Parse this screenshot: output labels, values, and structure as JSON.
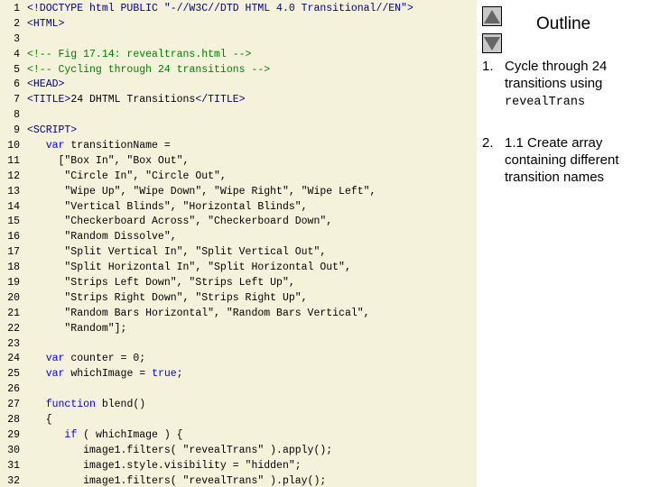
{
  "code": {
    "lines": [
      {
        "n": "1",
        "parts": [
          [
            "tag",
            "<!DOCTYPE html PUBLIC \"-//W3C//DTD HTML 4.0 Transitional//EN\">"
          ]
        ]
      },
      {
        "n": "2",
        "parts": [
          [
            "tag",
            "<HTML>"
          ]
        ]
      },
      {
        "n": "3",
        "parts": []
      },
      {
        "n": "4",
        "parts": [
          [
            "comment",
            "<!-- Fig 17.14: revealtrans.html -->"
          ]
        ]
      },
      {
        "n": "5",
        "parts": [
          [
            "comment",
            "<!-- Cycling through 24 transitions -->"
          ]
        ]
      },
      {
        "n": "6",
        "parts": [
          [
            "tag",
            "<HEAD>"
          ]
        ]
      },
      {
        "n": "7",
        "parts": [
          [
            "tag",
            "<TITLE>"
          ],
          [
            "plain",
            "24 DHTML Transitions"
          ],
          [
            "tag",
            "</TITLE>"
          ]
        ]
      },
      {
        "n": "8",
        "parts": []
      },
      {
        "n": "9",
        "parts": [
          [
            "tag",
            "<SCRIPT>"
          ]
        ]
      },
      {
        "n": "10",
        "parts": [
          [
            "plain",
            "   "
          ],
          [
            "kw",
            "var"
          ],
          [
            "plain",
            " transitionName ="
          ]
        ]
      },
      {
        "n": "11",
        "parts": [
          [
            "plain",
            "     [\"Box In\", \"Box Out\","
          ]
        ]
      },
      {
        "n": "12",
        "parts": [
          [
            "plain",
            "      \"Circle In\", \"Circle Out\","
          ]
        ]
      },
      {
        "n": "13",
        "parts": [
          [
            "plain",
            "      \"Wipe Up\", \"Wipe Down\", \"Wipe Right\", \"Wipe Left\","
          ]
        ]
      },
      {
        "n": "14",
        "parts": [
          [
            "plain",
            "      \"Vertical Blinds\", \"Horizontal Blinds\","
          ]
        ]
      },
      {
        "n": "15",
        "parts": [
          [
            "plain",
            "      \"Checkerboard Across\", \"Checkerboard Down\","
          ]
        ]
      },
      {
        "n": "16",
        "parts": [
          [
            "plain",
            "      \"Random Dissolve\","
          ]
        ]
      },
      {
        "n": "17",
        "parts": [
          [
            "plain",
            "      \"Split Vertical In\", \"Split Vertical Out\","
          ]
        ]
      },
      {
        "n": "18",
        "parts": [
          [
            "plain",
            "      \"Split Horizontal In\", \"Split Horizontal Out\","
          ]
        ]
      },
      {
        "n": "19",
        "parts": [
          [
            "plain",
            "      \"Strips Left Down\", \"Strips Left Up\","
          ]
        ]
      },
      {
        "n": "20",
        "parts": [
          [
            "plain",
            "      \"Strips Right Down\", \"Strips Right Up\","
          ]
        ]
      },
      {
        "n": "21",
        "parts": [
          [
            "plain",
            "      \"Random Bars Horizontal\", \"Random Bars Vertical\","
          ]
        ]
      },
      {
        "n": "22",
        "parts": [
          [
            "plain",
            "      \"Random\"];"
          ]
        ]
      },
      {
        "n": "23",
        "parts": []
      },
      {
        "n": "24",
        "parts": [
          [
            "plain",
            "   "
          ],
          [
            "kw",
            "var"
          ],
          [
            "plain",
            " counter = 0;"
          ]
        ]
      },
      {
        "n": "25",
        "parts": [
          [
            "plain",
            "   "
          ],
          [
            "kw",
            "var"
          ],
          [
            "plain",
            " whichImage = "
          ],
          [
            "kw",
            "true"
          ],
          [
            "plain",
            ";"
          ]
        ]
      },
      {
        "n": "26",
        "parts": []
      },
      {
        "n": "27",
        "parts": [
          [
            "plain",
            "   "
          ],
          [
            "kw",
            "function"
          ],
          [
            "plain",
            " blend()"
          ]
        ]
      },
      {
        "n": "28",
        "parts": [
          [
            "plain",
            "   {"
          ]
        ]
      },
      {
        "n": "29",
        "parts": [
          [
            "plain",
            "      "
          ],
          [
            "kw",
            "if"
          ],
          [
            "plain",
            " ( whichImage ) {"
          ]
        ]
      },
      {
        "n": "30",
        "parts": [
          [
            "plain",
            "         image1.filters( \"revealTrans\" ).apply();"
          ]
        ]
      },
      {
        "n": "31",
        "parts": [
          [
            "plain",
            "         image1.style.visibility = \"hidden\";"
          ]
        ]
      },
      {
        "n": "32",
        "parts": [
          [
            "plain",
            "         image1.filters( \"revealTrans\" ).play();"
          ]
        ]
      }
    ]
  },
  "outline": {
    "title": "Outline",
    "item1_number": "1.",
    "item1_text": "Cycle through 24 transitions using",
    "item1_code": "revealTrans",
    "item2_number": "2.",
    "item2_text": "1.1    Create array containing different transition names"
  },
  "colors": {
    "code_background": "#f5f2dc",
    "tag": "#000080",
    "comment": "#008000",
    "keyword": "#0000ff"
  },
  "icons": {
    "up": "triangle-up-icon",
    "down": "triangle-down-icon"
  }
}
